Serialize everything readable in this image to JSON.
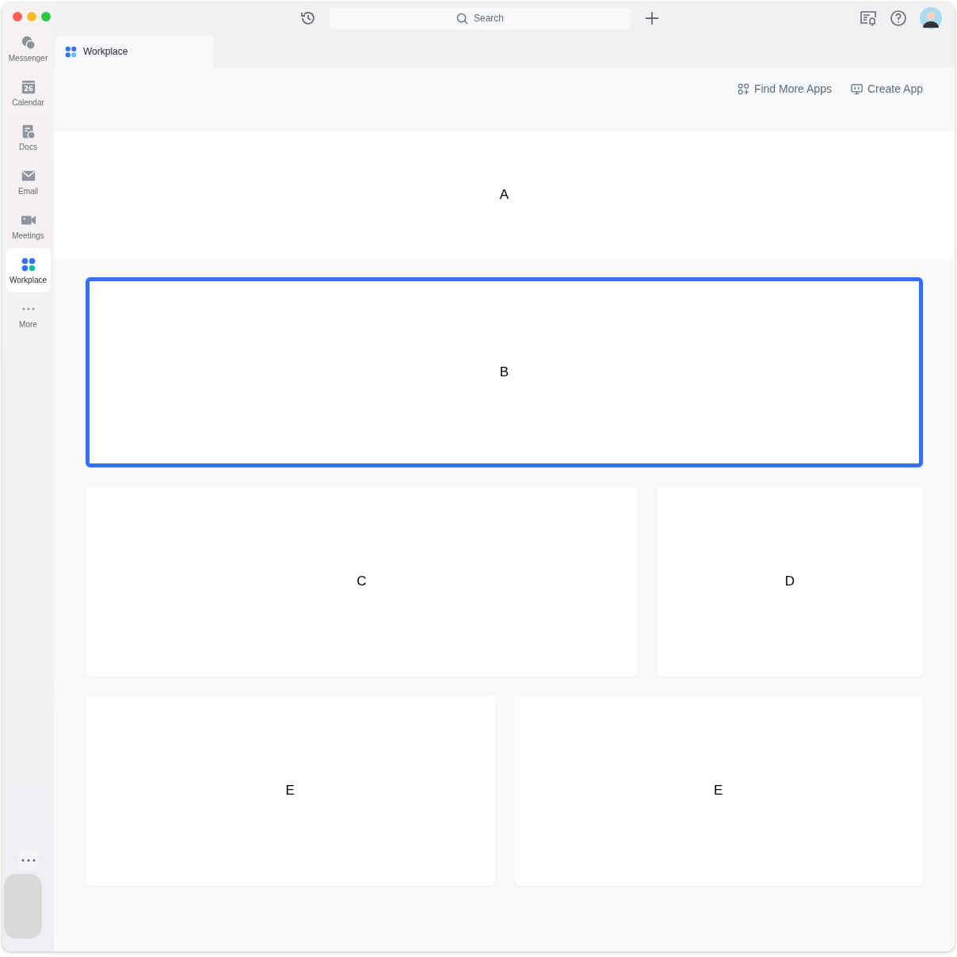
{
  "search": {
    "placeholder": "Search"
  },
  "sidebar": {
    "items": [
      {
        "label": "Messenger",
        "selected": false
      },
      {
        "label": "Calendar",
        "badge": "26",
        "selected": false
      },
      {
        "label": "Docs",
        "selected": false
      },
      {
        "label": "Email",
        "selected": false
      },
      {
        "label": "Meetings",
        "selected": false
      },
      {
        "label": "Workplace",
        "selected": true
      },
      {
        "label": "More",
        "selected": false
      }
    ]
  },
  "tabs": [
    {
      "label": "Workplace",
      "selected": true
    }
  ],
  "toolbar": {
    "actions": [
      {
        "label": "Find More Apps"
      },
      {
        "label": "Create App"
      }
    ]
  },
  "banner": {
    "label": "A"
  },
  "rows": [
    {
      "kind": "full",
      "cards": [
        {
          "label": "B",
          "highlighted": true
        }
      ]
    },
    {
      "kind": "wide-narrow",
      "cards": [
        {
          "label": "C",
          "highlighted": false
        },
        {
          "label": "D",
          "highlighted": false
        }
      ]
    },
    {
      "kind": "equal",
      "cards": [
        {
          "label": "E",
          "highlighted": false
        },
        {
          "label": "E",
          "highlighted": false
        }
      ]
    }
  ]
}
